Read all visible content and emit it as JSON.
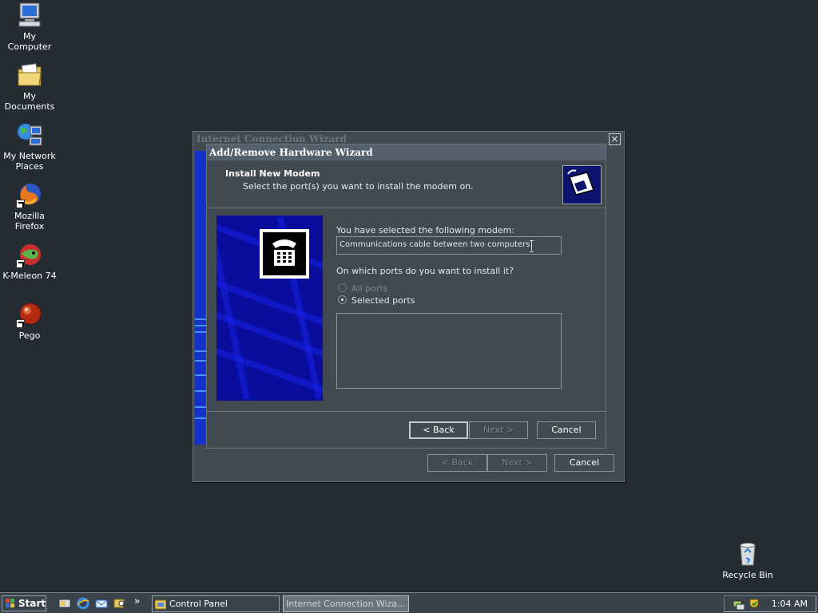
{
  "desktop": {
    "icons": [
      {
        "label": "My Computer",
        "icon": "computer-icon"
      },
      {
        "label": "My Documents",
        "icon": "folder-documents-icon"
      },
      {
        "label": "My Network Places",
        "icon": "network-icon"
      },
      {
        "label": "Mozilla Firefox",
        "icon": "firefox-icon"
      },
      {
        "label": "K-Meleon 74",
        "icon": "kmeleon-icon"
      },
      {
        "label": "Pego",
        "icon": "pego-icon"
      },
      {
        "label": "Recycle Bin",
        "icon": "recycle-bin-icon"
      }
    ]
  },
  "outer_wizard": {
    "title": "Internet Connection Wizard",
    "close_label": "×",
    "back_label": "< Back",
    "next_label": "Next >",
    "cancel_label": "Cancel"
  },
  "inner_wizard": {
    "title": "Add/Remove Hardware Wizard",
    "header_title": "Install New Modem",
    "header_subtitle": "Select the port(s) you want to install the modem on.",
    "selected_label": "You have selected the following modem:",
    "modem_name": "Communications cable between two computers",
    "ports_question": "On which ports do you want to install it?",
    "radio_all": "All ports",
    "radio_selected": "Selected ports",
    "selected_radio": "Selected ports",
    "back_label": "< Back",
    "next_label": "Next >",
    "cancel_label": "Cancel"
  },
  "taskbar": {
    "start_label": "Start",
    "tasks": [
      {
        "label": "Control Panel",
        "active": false
      },
      {
        "label": "Internet Connection Wiza...",
        "active": true
      }
    ],
    "overflow_label": "»",
    "clock": "1:04 AM"
  },
  "colors": {
    "desktop": "#242b33",
    "window": "#414951",
    "accent_blue": "#0a0c9c"
  }
}
